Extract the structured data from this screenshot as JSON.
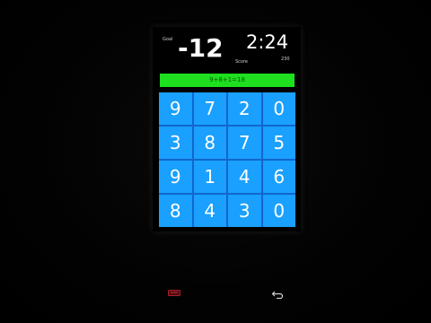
{
  "header": {
    "goal_label": "Goal",
    "goal_value": "-12",
    "timer": "2:24",
    "score_label": "Score",
    "score_value": "230"
  },
  "equation": "9+8+1=18",
  "grid": {
    "rows": [
      [
        "9",
        "7",
        "2",
        "0"
      ],
      [
        "3",
        "8",
        "7",
        "5"
      ],
      [
        "9",
        "1",
        "4",
        "6"
      ],
      [
        "8",
        "4",
        "3",
        "0"
      ]
    ]
  },
  "colors": {
    "tile": "#1aa0ff",
    "equation_bar": "#1ee01e",
    "background": "#000000"
  },
  "icons": {
    "menu": "menu-icon",
    "back": "back-arrow-icon"
  }
}
